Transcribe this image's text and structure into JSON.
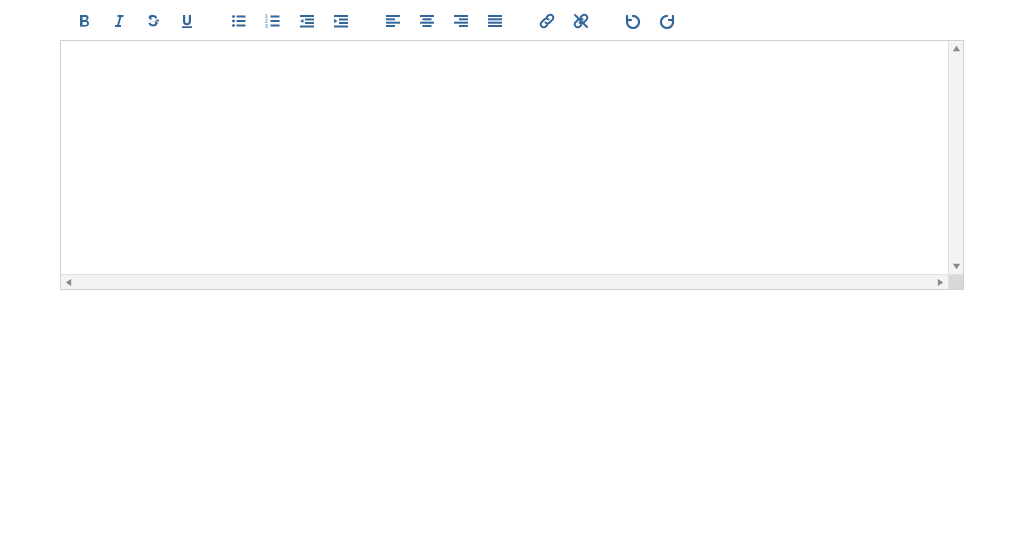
{
  "toolbar": {
    "buttons": [
      {
        "id": "bold",
        "icon": "bold-icon",
        "title": "Bold"
      },
      {
        "id": "italic",
        "icon": "italic-icon",
        "title": "Italic"
      },
      {
        "id": "strike",
        "icon": "strikethrough-icon",
        "title": "Strikethrough"
      },
      {
        "id": "underline",
        "icon": "underline-icon",
        "title": "Underline"
      },
      {
        "sep": true
      },
      {
        "id": "ul",
        "icon": "list-ul-icon",
        "title": "Bulleted list"
      },
      {
        "id": "ol",
        "icon": "list-ol-icon",
        "title": "Numbered list"
      },
      {
        "id": "outdent",
        "icon": "outdent-icon",
        "title": "Decrease indent"
      },
      {
        "id": "indent",
        "icon": "indent-icon",
        "title": "Increase indent"
      },
      {
        "sep": true
      },
      {
        "id": "align-left",
        "icon": "align-left-icon",
        "title": "Align left"
      },
      {
        "id": "align-center",
        "icon": "align-center-icon",
        "title": "Align center"
      },
      {
        "id": "align-right",
        "icon": "align-right-icon",
        "title": "Align right"
      },
      {
        "id": "align-justify",
        "icon": "align-justify-icon",
        "title": "Justify"
      },
      {
        "sep": true
      },
      {
        "id": "link",
        "icon": "link-icon",
        "title": "Insert link"
      },
      {
        "id": "unlink",
        "icon": "unlink-icon",
        "title": "Remove link"
      },
      {
        "sep": true
      },
      {
        "id": "undo",
        "icon": "undo-icon",
        "title": "Undo"
      },
      {
        "id": "redo",
        "icon": "redo-icon",
        "title": "Redo"
      }
    ]
  },
  "editor": {
    "content": "",
    "placeholder": ""
  },
  "colors": {
    "icon": "#336699"
  }
}
